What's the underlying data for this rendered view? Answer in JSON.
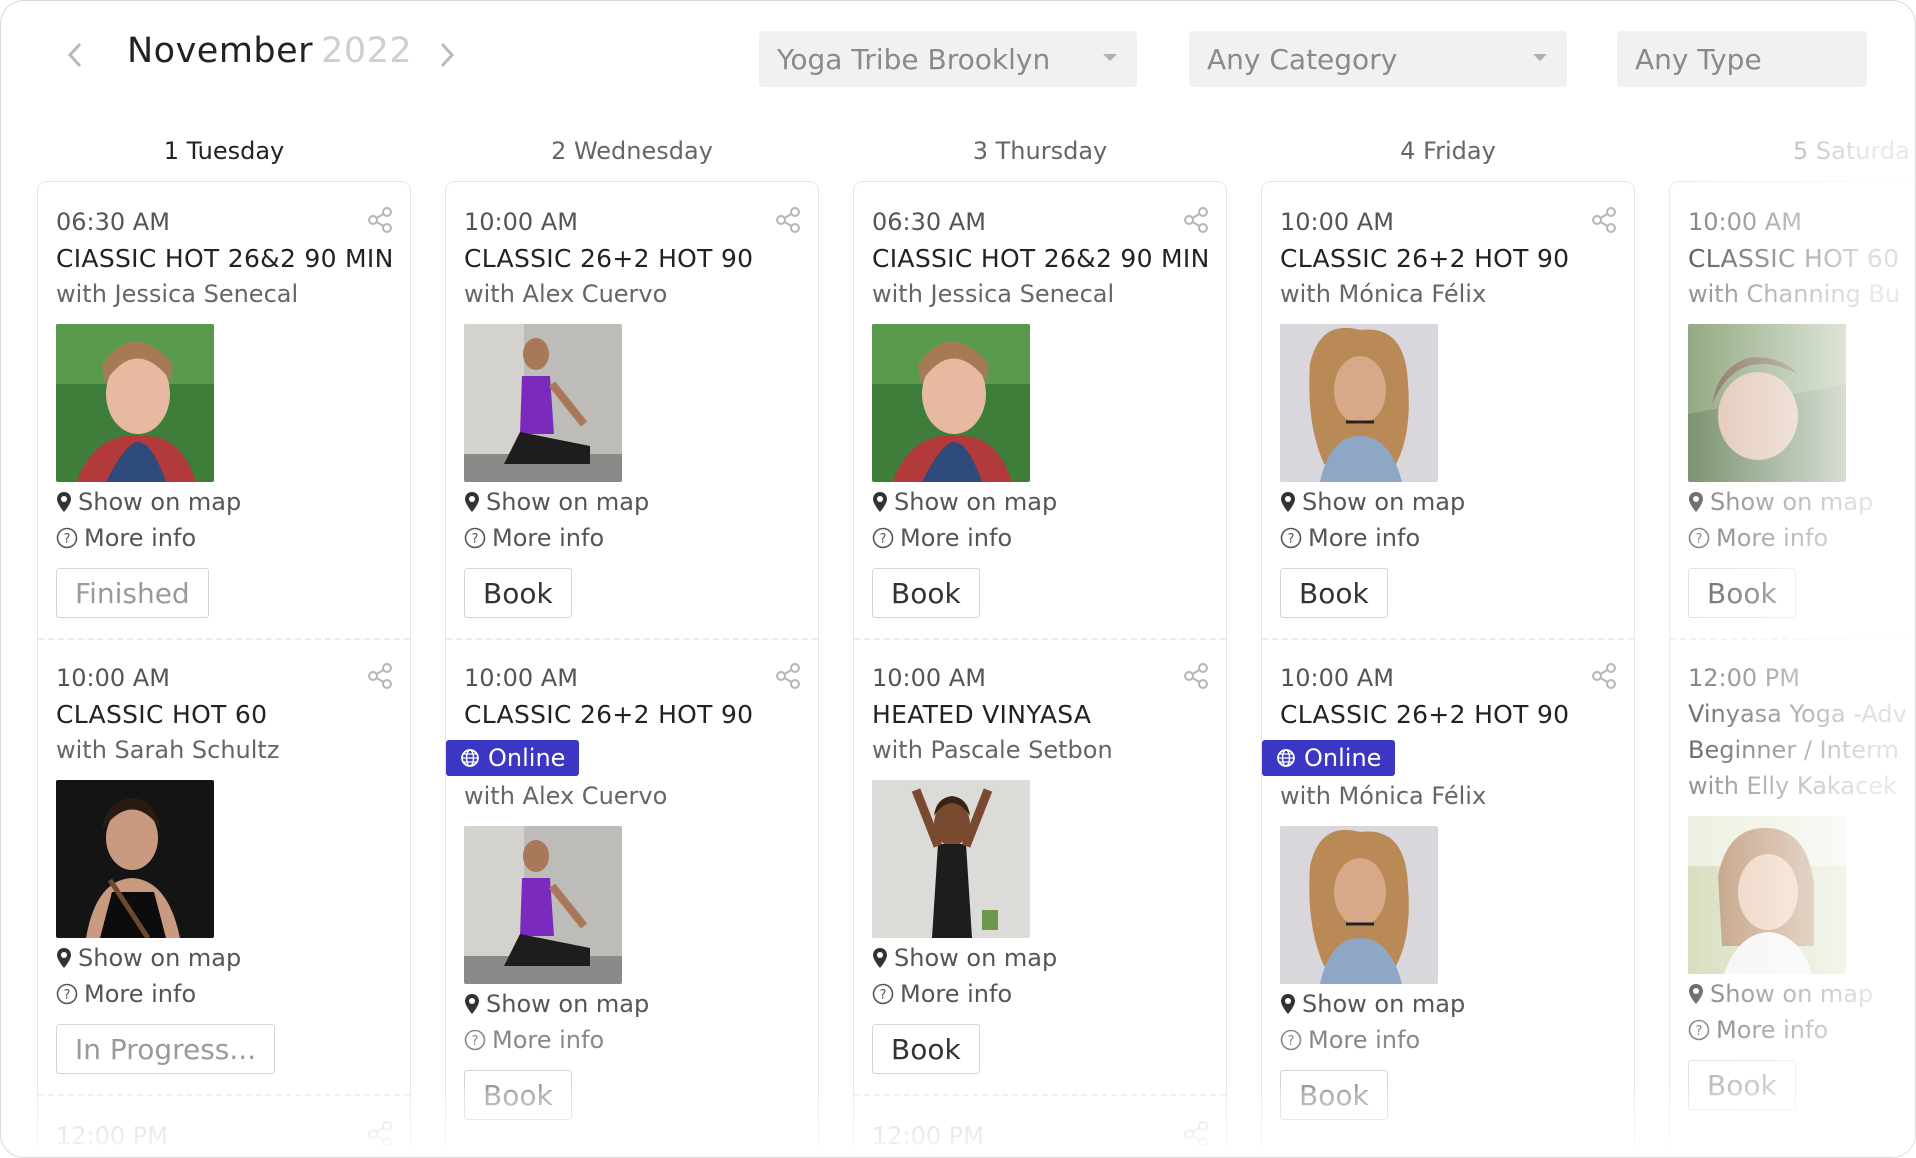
{
  "header": {
    "month": "November",
    "year": "2022",
    "prev_icon": "chevron-left-icon",
    "next_icon": "chevron-right-icon",
    "filters": {
      "location": "Yoga Tribe Brooklyn",
      "category": "Any Category",
      "type": "Any Type"
    }
  },
  "days": [
    {
      "label": "1 Tuesday",
      "classes": [
        {
          "time": "06:30 AM",
          "title": "CIASSIC HOT 26&2 90 MIN",
          "teacher": "with Jessica Senecal",
          "map": "Show on map",
          "info": "More info",
          "button": "Finished"
        },
        {
          "time": "10:00 AM",
          "title": "CLASSIC HOT 60",
          "teacher": "with Sarah Schultz",
          "map": "Show on map",
          "info": "More info",
          "button": "In Progress..."
        },
        {
          "time": "12:00 PM"
        }
      ]
    },
    {
      "label": "2 Wednesday",
      "classes": [
        {
          "time": "10:00 AM",
          "title": "CLASSIC 26+2 HOT 90",
          "teacher": "with Alex Cuervo",
          "map": "Show on map",
          "info": "More info",
          "button": "Book"
        },
        {
          "time": "10:00 AM",
          "title": "CLASSIC 26+2 HOT 90",
          "badge": "Online",
          "teacher": "with Alex Cuervo",
          "map": "Show on map",
          "info": "More info",
          "button": "Book"
        }
      ]
    },
    {
      "label": "3 Thursday",
      "classes": [
        {
          "time": "06:30 AM",
          "title": "CIASSIC HOT 26&2 90 MIN",
          "teacher": "with Jessica Senecal",
          "map": "Show on map",
          "info": "More info",
          "button": "Book"
        },
        {
          "time": "10:00 AM",
          "title": "HEATED VINYASA",
          "teacher": "with Pascale Setbon",
          "map": "Show on map",
          "info": "More info",
          "button": "Book"
        },
        {
          "time": "12:00 PM"
        }
      ]
    },
    {
      "label": "4 Friday",
      "classes": [
        {
          "time": "10:00 AM",
          "title": "CLASSIC 26+2 HOT 90",
          "teacher": "with Mónica Félix",
          "map": "Show on map",
          "info": "More info",
          "button": "Book"
        },
        {
          "time": "10:00 AM",
          "title": "CLASSIC 26+2 HOT 90",
          "badge": "Online",
          "teacher": "with Mónica Félix",
          "map": "Show on map",
          "info": "More info",
          "button": "Book"
        }
      ]
    },
    {
      "label": "5 Saturda",
      "classes": [
        {
          "time": "10:00 AM",
          "title": "CLASSIC HOT 60",
          "teacher": "with Channing Bu",
          "map": "Show on map",
          "info": "More info",
          "button": "Book"
        },
        {
          "time": "12:00 PM",
          "title_line1": "Vinyasa Yoga -Adv",
          "title_line2": "Beginner / Interm",
          "teacher": "with Elly Kakacek",
          "map": "Show on map",
          "info": "More info",
          "button": "Book"
        }
      ]
    }
  ],
  "colors": {
    "online_badge": "#3b36c4",
    "accent_text": "#222222"
  }
}
